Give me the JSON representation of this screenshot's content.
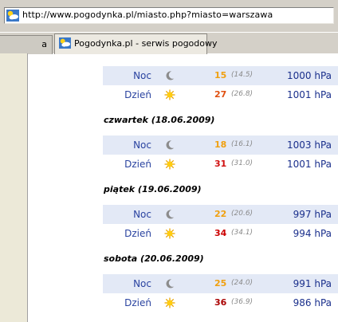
{
  "browser": {
    "url": "http://www.pogodynka.pl/miasto.php?miasto=warszawa",
    "tabs": [
      {
        "label": "a"
      },
      {
        "label": "Pogodynka.pl - serwis pogodowy"
      }
    ]
  },
  "forecast": {
    "top_rows": [
      {
        "period": "Noc",
        "icon": "moon-icon",
        "temp": "15",
        "feel": "(14.5)",
        "pressure": "1000 hPa",
        "temp_color": "#f0a010"
      },
      {
        "period": "Dzień",
        "icon": "sun-icon",
        "temp": "27",
        "feel": "(26.8)",
        "pressure": "1001 hPa",
        "temp_color": "#e05010"
      }
    ],
    "days": [
      {
        "date": "czwartek (18.06.2009)",
        "rows": [
          {
            "period": "Noc",
            "icon": "moon-icon",
            "temp": "18",
            "feel": "(16.1)",
            "pressure": "1003 hPa",
            "temp_color": "#f0a010"
          },
          {
            "period": "Dzień",
            "icon": "sun-icon",
            "temp": "31",
            "feel": "(31.0)",
            "pressure": "1001 hPa",
            "temp_color": "#d01010"
          }
        ]
      },
      {
        "date": "piątek (19.06.2009)",
        "rows": [
          {
            "period": "Noc",
            "icon": "moon-icon",
            "temp": "22",
            "feel": "(20.6)",
            "pressure": "997 hPa",
            "temp_color": "#f0a010"
          },
          {
            "period": "Dzień",
            "icon": "sun-icon",
            "temp": "34",
            "feel": "(34.1)",
            "pressure": "994 hPa",
            "temp_color": "#cc0000"
          }
        ]
      },
      {
        "date": "sobota (20.06.2009)",
        "rows": [
          {
            "period": "Noc",
            "icon": "moon-icon",
            "temp": "25",
            "feel": "(24.0)",
            "pressure": "991 hPa",
            "temp_color": "#f0a010"
          },
          {
            "period": "Dzień",
            "icon": "sun-icon",
            "temp": "36",
            "feel": "(36.9)",
            "pressure": "986 hPa",
            "temp_color": "#aa0000"
          }
        ]
      }
    ]
  }
}
